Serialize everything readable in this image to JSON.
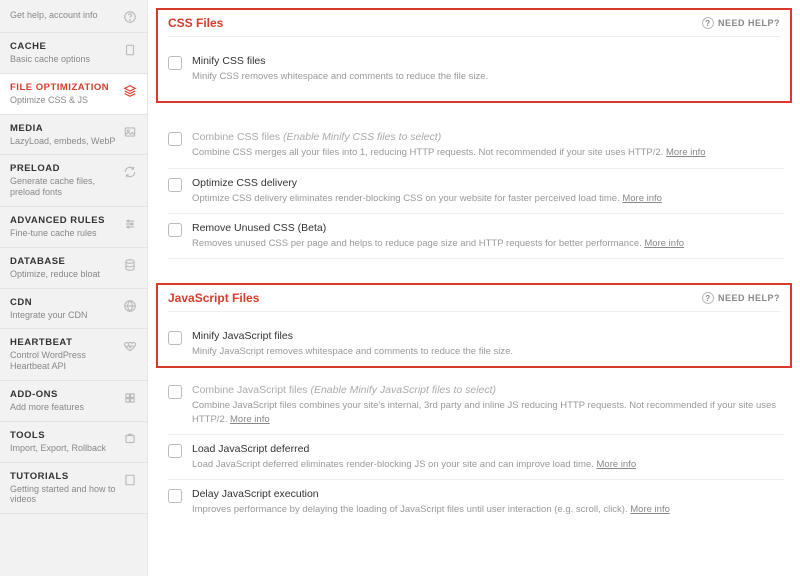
{
  "sidebar": {
    "items": [
      {
        "title": "",
        "sub": "Get help, account info",
        "icon": "question-icon"
      },
      {
        "title": "CACHE",
        "sub": "Basic cache options",
        "icon": "file-icon"
      },
      {
        "title": "FILE OPTIMIZATION",
        "sub": "Optimize CSS & JS",
        "icon": "layers-icon"
      },
      {
        "title": "MEDIA",
        "sub": "LazyLoad, embeds, WebP",
        "icon": "image-icon"
      },
      {
        "title": "PRELOAD",
        "sub": "Generate cache files, preload fonts",
        "icon": "refresh-icon"
      },
      {
        "title": "ADVANCED RULES",
        "sub": "Fine-tune cache rules",
        "icon": "sliders-icon"
      },
      {
        "title": "DATABASE",
        "sub": "Optimize, reduce bloat",
        "icon": "database-icon"
      },
      {
        "title": "CDN",
        "sub": "Integrate your CDN",
        "icon": "globe-icon"
      },
      {
        "title": "HEARTBEAT",
        "sub": "Control WordPress Heartbeat API",
        "icon": "heart-icon"
      },
      {
        "title": "ADD-ONS",
        "sub": "Add more features",
        "icon": "addon-icon"
      },
      {
        "title": "TOOLS",
        "sub": "Import, Export, Rollback",
        "icon": "tools-icon"
      },
      {
        "title": "TUTORIALS",
        "sub": "Getting started and how to videos",
        "icon": "book-icon"
      }
    ]
  },
  "help_label": "NEED HELP?",
  "more_info": "More info",
  "css": {
    "heading": "CSS Files",
    "opts": [
      {
        "title": "Minify CSS files",
        "desc": "Minify CSS removes whitespace and comments to reduce the file size."
      },
      {
        "title": "Combine CSS files",
        "hint": "(Enable Minify CSS files to select)",
        "desc": "Combine CSS merges all your files into 1, reducing HTTP requests. Not recommended if your site uses HTTP/2."
      },
      {
        "title": "Optimize CSS delivery",
        "desc": "Optimize CSS delivery eliminates render-blocking CSS on your website for faster perceived load time."
      },
      {
        "title": "Remove Unused CSS (Beta)",
        "desc": "Removes unused CSS per page and helps to reduce page size and HTTP requests for better performance."
      }
    ]
  },
  "js": {
    "heading": "JavaScript Files",
    "opts": [
      {
        "title": "Minify JavaScript files",
        "desc": "Minify JavaScript removes whitespace and comments to reduce the file size."
      },
      {
        "title": "Combine JavaScript files",
        "hint": "(Enable Minify JavaScript files to select)",
        "desc": "Combine JavaScript files combines your site's internal, 3rd party and inline JS reducing HTTP requests. Not recommended if your site uses HTTP/2."
      },
      {
        "title": "Load JavaScript deferred",
        "desc": "Load JavaScript deferred eliminates render-blocking JS on your site and can improve load time."
      },
      {
        "title": "Delay JavaScript execution",
        "desc": "Improves performance by delaying the loading of JavaScript files until user interaction (e.g. scroll, click)."
      }
    ]
  }
}
